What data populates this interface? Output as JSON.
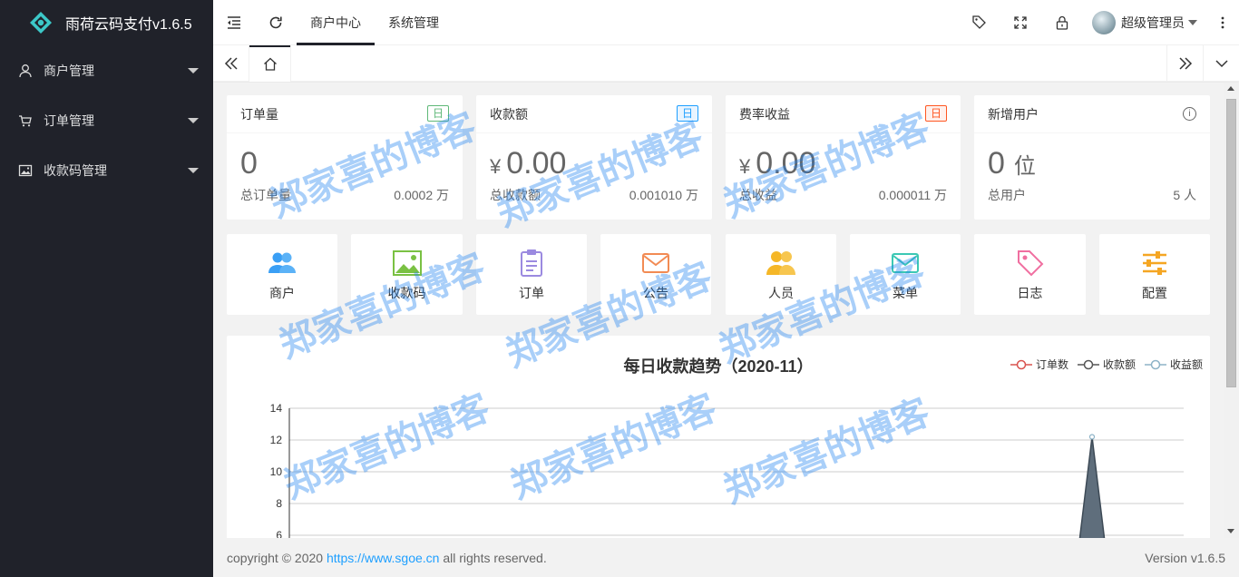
{
  "app": {
    "title": "雨荷云码支付v1.6.5"
  },
  "sidebar": {
    "items": [
      {
        "label": "商户管理",
        "icon": "user-icon"
      },
      {
        "label": "订单管理",
        "icon": "cart-icon"
      },
      {
        "label": "收款码管理",
        "icon": "image-icon"
      }
    ]
  },
  "header": {
    "tabs": [
      {
        "label": "商户中心",
        "active": true
      },
      {
        "label": "系统管理",
        "active": false
      }
    ],
    "user_name": "超级管理员"
  },
  "stats": [
    {
      "title": "订单量",
      "badge": "日",
      "badge_color": "#5FB878",
      "value": "0",
      "prefix": "",
      "unit": "",
      "foot_label": "总订单量",
      "foot_value": "0.0002 万"
    },
    {
      "title": "收款额",
      "badge": "日",
      "badge_color": "#1E9FFF",
      "value": "0.00",
      "prefix": "¥",
      "unit": "",
      "foot_label": "总收款额",
      "foot_value": "0.001010 万"
    },
    {
      "title": "费率收益",
      "badge": "日",
      "badge_color": "#FF5722",
      "value": "0.00",
      "prefix": "¥",
      "unit": "",
      "foot_label": "总收益",
      "foot_value": "0.000011 万"
    },
    {
      "title": "新增用户",
      "badge": "",
      "value": "0",
      "prefix": "",
      "unit": "位",
      "foot_label": "总用户",
      "foot_value": "5 人"
    }
  ],
  "shortcuts": [
    {
      "label": "商户",
      "icon": "users-icon",
      "color": "#3a9ff5"
    },
    {
      "label": "收款码",
      "icon": "picture-icon",
      "color": "#7ac143"
    },
    {
      "label": "订单",
      "icon": "clipboard-icon",
      "color": "#9b8ae0"
    },
    {
      "label": "公告",
      "icon": "mail-icon",
      "color": "#f28b54"
    },
    {
      "label": "人员",
      "icon": "people-icon",
      "color": "#f5b727"
    },
    {
      "label": "菜单",
      "icon": "envelope-icon",
      "color": "#3cc8b4"
    },
    {
      "label": "日志",
      "icon": "tag-icon",
      "color": "#f06fa0"
    },
    {
      "label": "配置",
      "icon": "sliders-icon",
      "color": "#f5a623"
    }
  ],
  "chart_data": {
    "type": "line",
    "title": "每日收款趋势（2020-11）",
    "series": [
      {
        "name": "订单数",
        "color": "#d9534f"
      },
      {
        "name": "收款额",
        "color": "#555555"
      },
      {
        "name": "收益额",
        "color": "#8db3c7"
      }
    ],
    "y_ticks": [
      "14",
      "12",
      "10",
      "8",
      "6"
    ],
    "ylim": [
      0,
      14
    ],
    "peak": {
      "series": "收款额",
      "value": 12.2
    }
  },
  "footer": {
    "copyright_prefix": "copyright © 2020",
    "link": "https://www.sgoe.cn",
    "copyright_suffix": "all rights reserved.",
    "version": "Version v1.6.5"
  },
  "watermark": "郑家喜的博客"
}
